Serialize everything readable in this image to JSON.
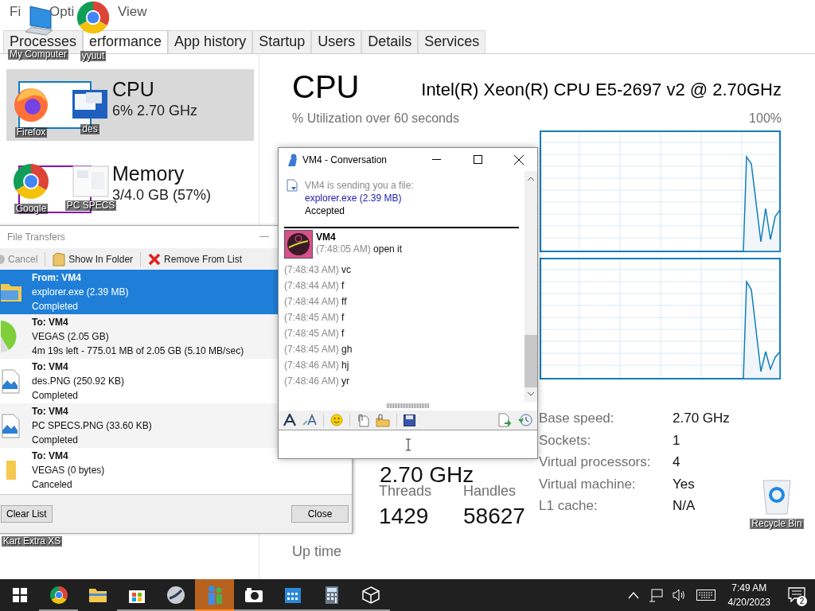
{
  "task_manager": {
    "menu": [
      {
        "label": "Fi"
      },
      {
        "label": "Opti"
      },
      {
        "label": "View"
      }
    ],
    "tabs": [
      {
        "label": "Processes",
        "selected": false
      },
      {
        "label": "erformance",
        "selected": true
      },
      {
        "label": "App history",
        "selected": false
      },
      {
        "label": "Startup",
        "selected": false
      },
      {
        "label": "Users",
        "selected": false
      },
      {
        "label": "Details",
        "selected": false
      },
      {
        "label": "Services",
        "selected": false
      }
    ],
    "resources": [
      {
        "name": "CPU",
        "detail": "6% 2.70 GHz",
        "selected": true,
        "color": "#117dbb"
      },
      {
        "name": "Memory",
        "detail": "3/4.0 GB (57%)",
        "selected": false,
        "color": "#8b12ae"
      }
    ],
    "title": "CPU",
    "model": "Intel(R) Xeon(R) CPU E5-2697 v2 @ 2.70GHz",
    "graph_label": "% Utilization over 60 seconds",
    "graph_max": "100%",
    "speed": "2.70 GHz",
    "counters": [
      {
        "label": "Threads",
        "value": "1429"
      },
      {
        "label": "Handles",
        "value": "58627"
      }
    ],
    "uptime_label": "Up time",
    "specs": [
      {
        "label": "Base speed:",
        "value": "2.70 GHz"
      },
      {
        "label": "Sockets:",
        "value": "1"
      },
      {
        "label": "Virtual processors:",
        "value": "4"
      },
      {
        "label": "Virtual machine:",
        "value": "Yes"
      },
      {
        "label": "L1 cache:",
        "value": "N/A"
      }
    ]
  },
  "desktop_icons": [
    {
      "label": "My Computer",
      "kind": "computer"
    },
    {
      "label": "yyuut",
      "kind": "chrome"
    },
    {
      "label": "Firefox",
      "kind": "firefox"
    },
    {
      "label": "des",
      "kind": "screenshot"
    },
    {
      "label": "Google",
      "kind": "chrome"
    },
    {
      "label": "PC SPECS",
      "kind": "document"
    },
    {
      "label": "Recycle Bin",
      "kind": "recycle"
    },
    {
      "label": "Kart Extra XS",
      "kind": "covered"
    }
  ],
  "file_transfers": {
    "title": "File Transfers",
    "toolbar": [
      {
        "label": "Cancel",
        "kind": "cancel",
        "disabled": true
      },
      {
        "label": "Show In Folder",
        "kind": "folder",
        "disabled": false
      },
      {
        "label": "Remove From List",
        "kind": "remove",
        "disabled": false
      }
    ],
    "items": [
      {
        "kind": "explorer",
        "heading": "From: VM4",
        "file": "explorer.exe (2.39 MB)",
        "status": "Completed",
        "selected": true
      },
      {
        "kind": "progress",
        "heading": "To: VM4",
        "file": "VEGAS (2.05 GB)",
        "status": "4m 19s left - 775.01 MB of 2.05 GB (5.10 MB/sec)",
        "selected": false
      },
      {
        "kind": "image",
        "heading": "To: VM4",
        "file": "des.PNG (250.92 KB)",
        "status": "Completed",
        "selected": false
      },
      {
        "kind": "image",
        "heading": "To: VM4",
        "file": "PC SPECS.PNG (33.60 KB)",
        "status": "Completed",
        "selected": false
      },
      {
        "kind": "folder",
        "heading": "To: VM4",
        "file": "VEGAS (0 bytes)",
        "status": "Canceled",
        "selected": false
      }
    ],
    "buttons": [
      {
        "label": "Clear List"
      },
      {
        "label": "Close"
      }
    ]
  },
  "conversation": {
    "title": "VM4 - Conversation",
    "notice": {
      "text": "VM4 is sending you a file:",
      "link": "explorer.exe (2.39 MB)",
      "status": "Accepted"
    },
    "sender": "VM4",
    "messages": [
      {
        "time": "(7:48:05 AM)",
        "text": "open it"
      },
      {
        "time": "(7:48:43 AM)",
        "text": "vc"
      },
      {
        "time": "(7:48:44 AM)",
        "text": "f"
      },
      {
        "time": "(7:48:44 AM)",
        "text": "ff"
      },
      {
        "time": "(7:48:45 AM)",
        "text": "f"
      },
      {
        "time": "(7:48:45 AM)",
        "text": "f"
      },
      {
        "time": "(7:48:45 AM)",
        "text": "gh"
      },
      {
        "time": "(7:48:46 AM)",
        "text": "hj"
      },
      {
        "time": "(7:48:46 AM)",
        "text": "yr"
      }
    ]
  },
  "taskbar": {
    "apps": [
      {
        "kind": "chrome",
        "running": true,
        "selected": false
      },
      {
        "kind": "folder",
        "running": false,
        "selected": false
      },
      {
        "kind": "store",
        "running": true,
        "selected": false
      },
      {
        "kind": "steam",
        "running": true,
        "selected": false
      },
      {
        "kind": "messenger",
        "running": true,
        "selected": true
      },
      {
        "kind": "camera",
        "running": true,
        "selected": false
      },
      {
        "kind": "calendar",
        "running": true,
        "selected": false
      },
      {
        "kind": "calculator",
        "running": true,
        "selected": false
      },
      {
        "kind": "cube",
        "running": true,
        "selected": false
      }
    ],
    "time": "7:49 AM",
    "date": "4/20/2023",
    "notifications": "2"
  }
}
